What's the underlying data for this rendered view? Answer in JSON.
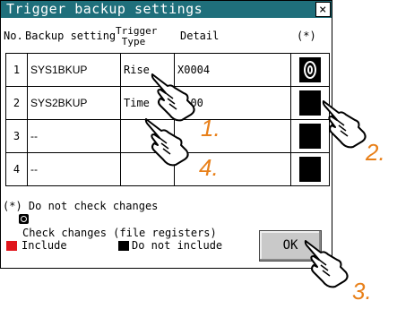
{
  "dialog": {
    "title": "Trigger backup settings",
    "close_glyph": "×"
  },
  "table": {
    "headers": {
      "no": "No.",
      "setting": "Backup setting",
      "type_line1": "Trigger",
      "type_line2": "Type",
      "detail": "Detail",
      "check": "(*)"
    },
    "rows": [
      {
        "no": "1",
        "setting": "SYS1BKUP",
        "type": "Rise",
        "detail": "X0004",
        "check": "do-not-check-icon"
      },
      {
        "no": "2",
        "setting": "SYS2BKUP",
        "type": "Time",
        "detail": "0:00",
        "check": "not-include-black"
      },
      {
        "no": "3",
        "setting": "--",
        "type": "",
        "detail": "",
        "check": "not-include-black"
      },
      {
        "no": "4",
        "setting": "--",
        "type": "",
        "detail": "",
        "check": "not-include-black"
      }
    ]
  },
  "notes": {
    "line1": "(*) Do not check changes",
    "line2": "Check changes (file registers)",
    "include_label": "Include",
    "exclude_label": "Do not include"
  },
  "buttons": {
    "ok": "OK"
  },
  "steps": {
    "s1": "1.",
    "s2": "2.",
    "s3": "3.",
    "s4": "4."
  },
  "colors": {
    "title_bar": "#1f6f7b",
    "include": "#e0151b",
    "exclude": "#000000",
    "step_numbers": "#e8801a"
  }
}
